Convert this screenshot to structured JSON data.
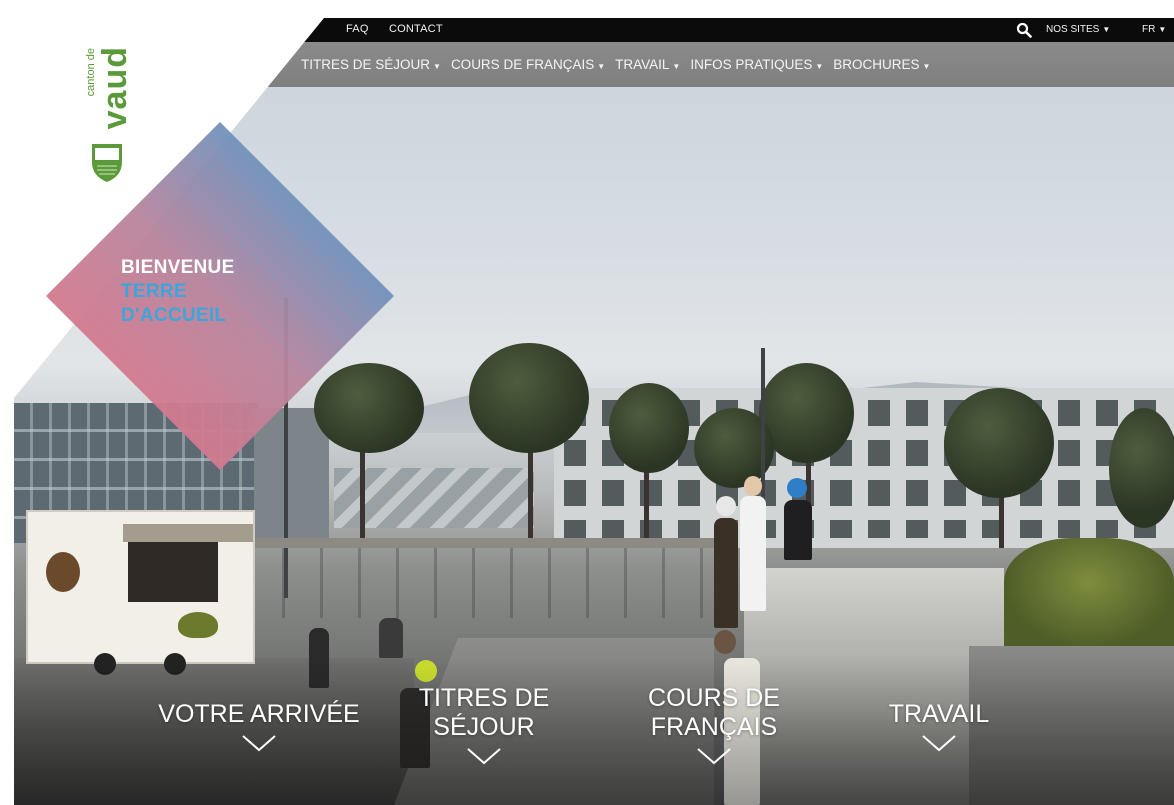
{
  "topbar": {
    "faq": "FAQ",
    "contact": "CONTACT",
    "search_icon": "search-icon",
    "nos_sites": "NOS SITES",
    "lang": "FR"
  },
  "nav": {
    "items": [
      {
        "label": "TITRES DE SÉJOUR"
      },
      {
        "label": "COURS DE FRANÇAIS"
      },
      {
        "label": "TRAVAIL"
      },
      {
        "label": "INFOS PRATIQUES"
      },
      {
        "label": "BROCHURES"
      }
    ],
    "caret": "▼"
  },
  "logo": {
    "small": "canton de",
    "big": "vaud",
    "color": "#5a9a3a"
  },
  "welcome": {
    "line1": "BIENVENUE",
    "line2": "TERRE",
    "line3": "D'ACCUEIL",
    "gradient_start": "#e96a7e",
    "gradient_end": "#2f9fd8"
  },
  "cta": [
    {
      "line1": "VOTRE ARRIVÉE",
      "line2": ""
    },
    {
      "line1": "TITRES DE",
      "line2": "SÉJOUR"
    },
    {
      "line1": "COURS DE",
      "line2": "FRANÇAIS"
    },
    {
      "line1": "TRAVAIL",
      "line2": ""
    }
  ]
}
